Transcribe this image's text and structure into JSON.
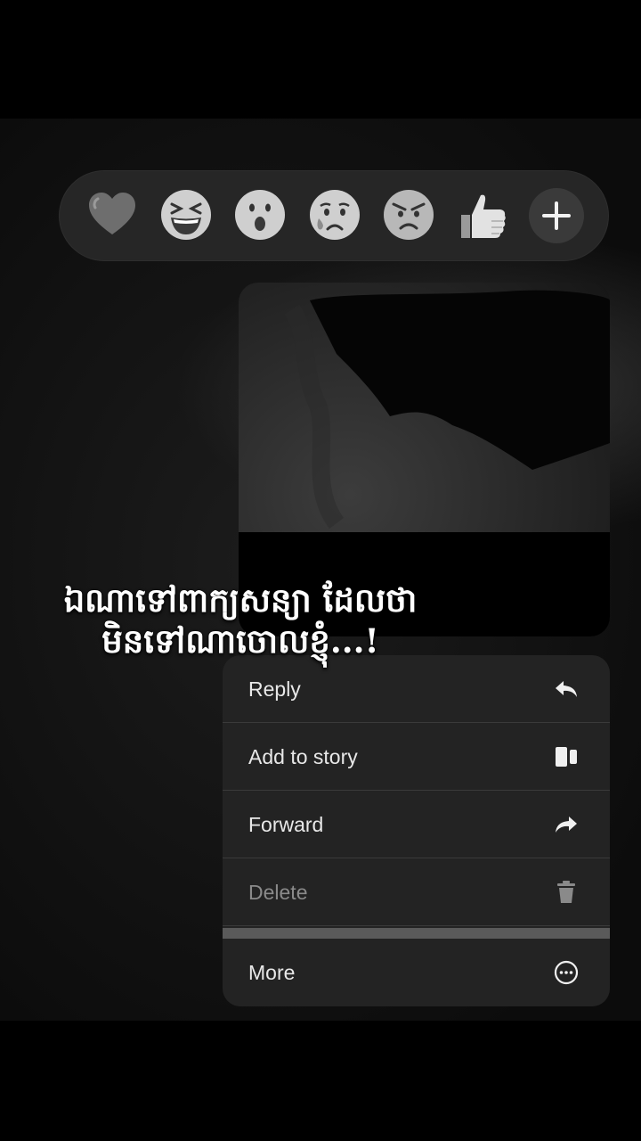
{
  "reactions": [
    {
      "name": "heart",
      "glyph": "🖤"
    },
    {
      "name": "laughing",
      "glyph": "😆"
    },
    {
      "name": "surprised",
      "glyph": "😮"
    },
    {
      "name": "crying",
      "glyph": "😢"
    },
    {
      "name": "angry",
      "glyph": "😠"
    },
    {
      "name": "thumbs-up",
      "glyph": "👍"
    }
  ],
  "caption": {
    "line1": "ឯណាទៅពាក្យសន្យា ដែលថា",
    "line2": "មិនទៅណាចោលខ្ញុំ...!"
  },
  "menu": {
    "reply": {
      "label": "Reply",
      "icon": "reply-icon"
    },
    "add_to_story": {
      "label": "Add to story",
      "icon": "story-icon"
    },
    "forward": {
      "label": "Forward",
      "icon": "forward-icon"
    },
    "delete": {
      "label": "Delete",
      "icon": "trash-icon"
    },
    "more": {
      "label": "More",
      "icon": "more-icon"
    }
  },
  "colors": {
    "menu_bg": "#232323",
    "reaction_bar_bg": "#262626",
    "text": "#e8e8e8",
    "disabled_text": "#8a8a8a"
  }
}
